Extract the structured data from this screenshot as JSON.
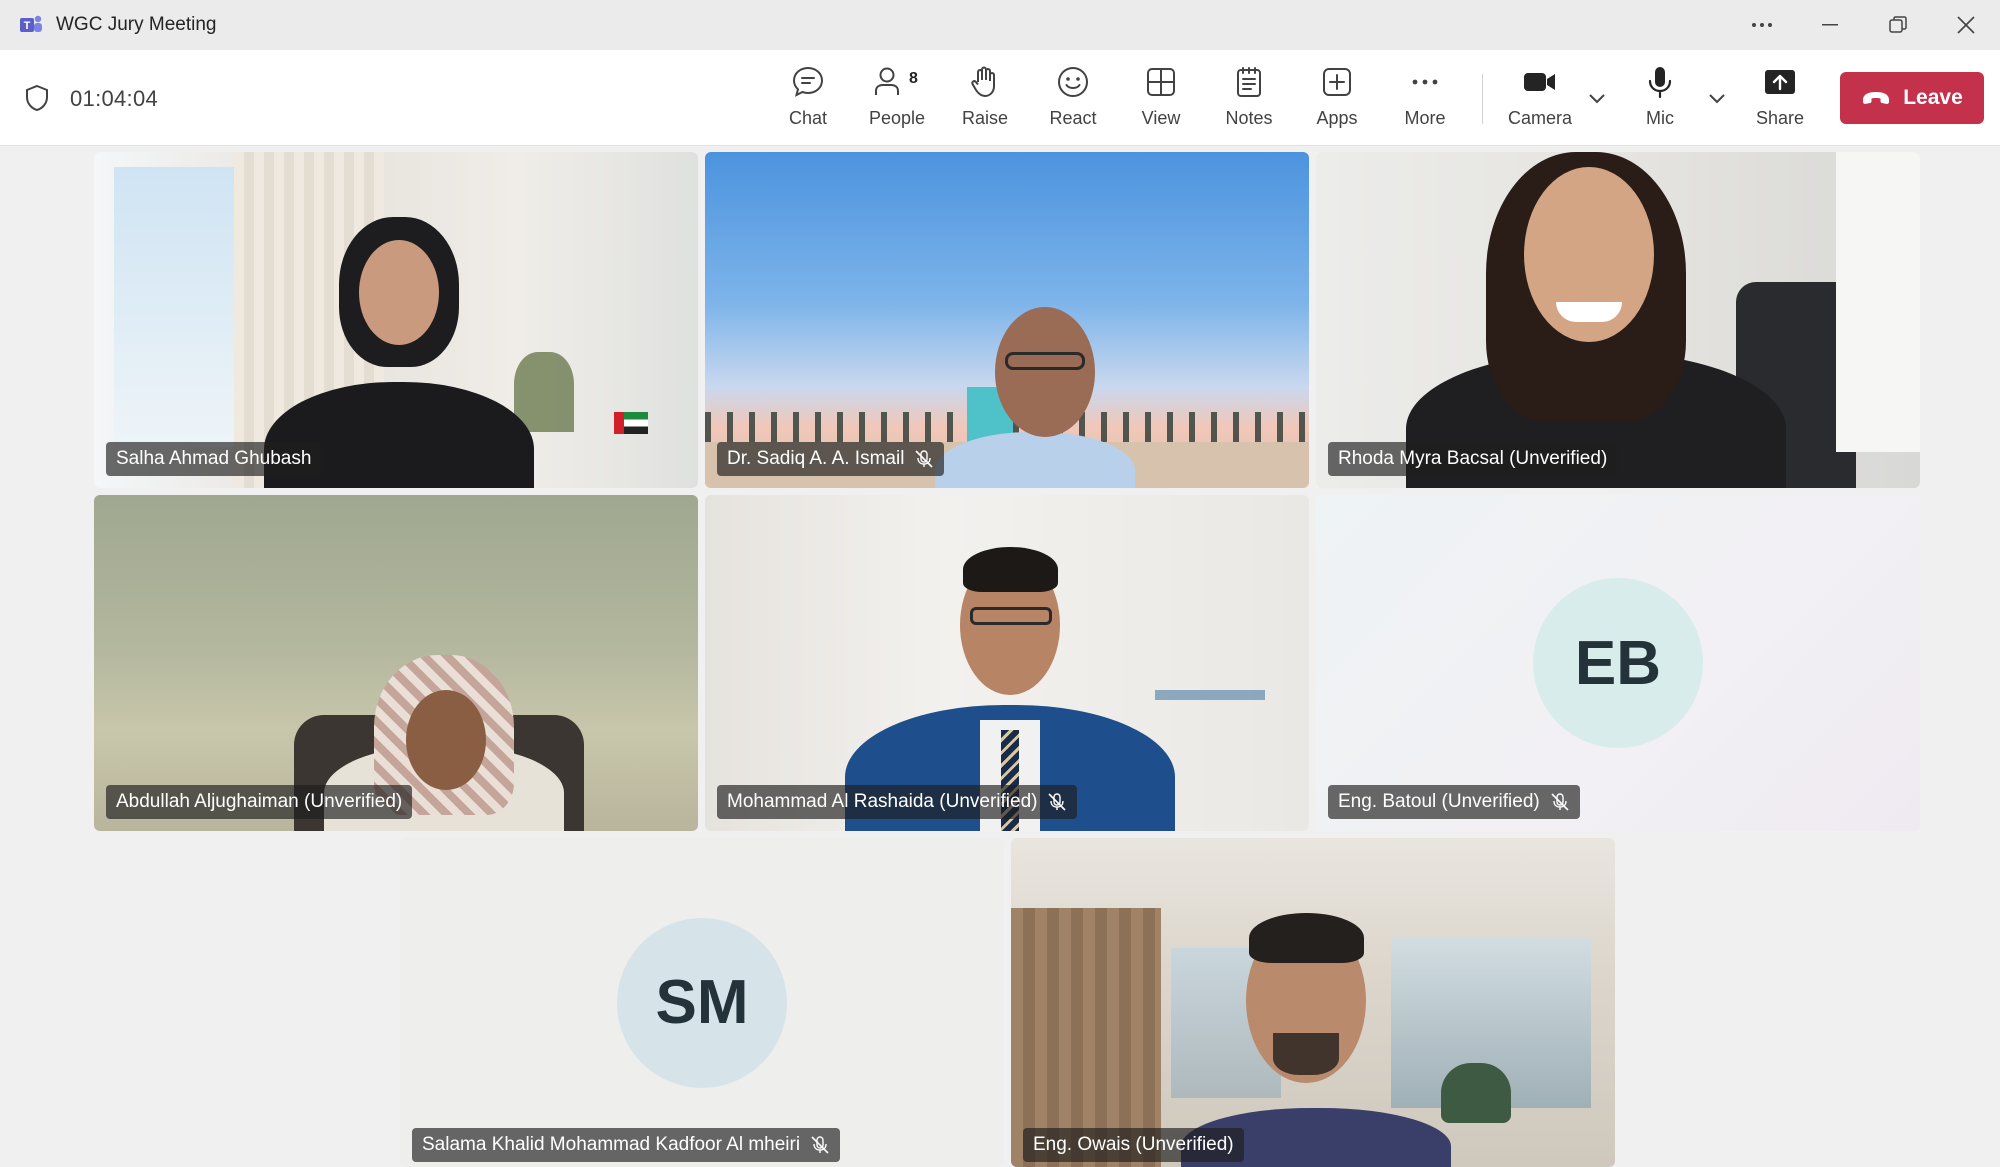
{
  "window": {
    "title": "WGC Jury Meeting"
  },
  "toolbar": {
    "timer": "01:04:04",
    "buttons": {
      "chat": "Chat",
      "people": "People",
      "people_count": "8",
      "raise": "Raise",
      "react": "React",
      "view": "View",
      "notes": "Notes",
      "apps": "Apps",
      "more": "More",
      "camera": "Camera",
      "mic": "Mic",
      "share": "Share"
    },
    "leave_label": "Leave",
    "leave_color": "#c4314b"
  },
  "participants": [
    {
      "name": "Salha Ahmad Ghubash",
      "muted": false,
      "video": true
    },
    {
      "name": "Dr. Sadiq A. A. Ismail",
      "muted": true,
      "video": true
    },
    {
      "name": "Rhoda Myra Bacsal (Unverified)",
      "muted": false,
      "video": true
    },
    {
      "name": "Abdullah Aljughaiman (Unverified)",
      "muted": false,
      "video": true
    },
    {
      "name": "Mohammad Al Rashaida (Unverified)",
      "muted": true,
      "video": true
    },
    {
      "name": "Eng. Batoul (Unverified)",
      "muted": true,
      "video": false,
      "initials": "EB"
    },
    {
      "name": "Salama Khalid Mohammad Kadfoor Al mheiri",
      "muted": true,
      "video": false,
      "initials": "SM"
    },
    {
      "name": "Eng. Owais (Unverified)",
      "muted": false,
      "video": true
    }
  ]
}
